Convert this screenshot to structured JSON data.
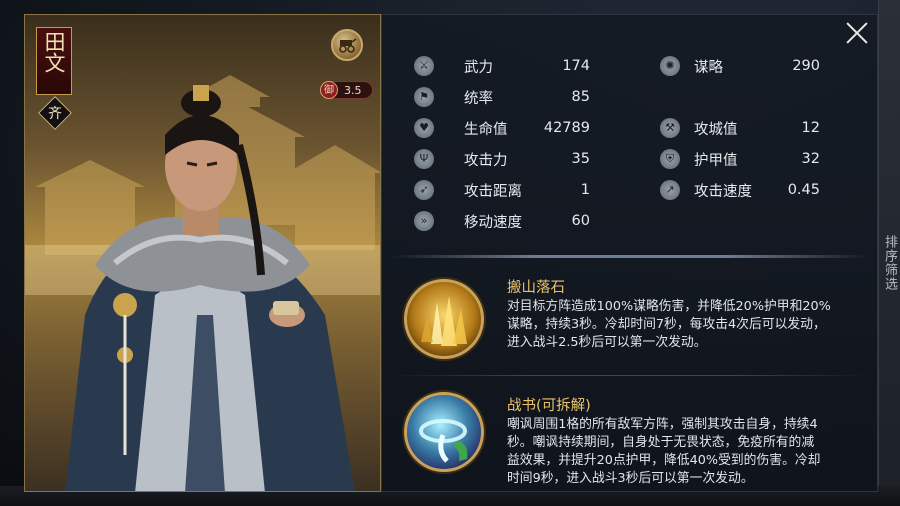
{
  "hero": {
    "name": "田文",
    "nation": "齐",
    "defense_badge": {
      "icon_text": "御",
      "value": "3.5"
    },
    "type_icon": "cart-icon"
  },
  "stats_left": [
    {
      "label": "武力",
      "value": "174",
      "icon": "crossed-swords-icon"
    },
    {
      "label": "统率",
      "value": "85",
      "icon": "banner-icon"
    },
    {
      "label": "生命值",
      "value": "42789",
      "icon": "heart-icon"
    },
    {
      "label": "攻击力",
      "value": "35",
      "icon": "trident-icon"
    },
    {
      "label": "攻击距离",
      "value": "1",
      "icon": "bow-icon"
    },
    {
      "label": "移动速度",
      "value": "60",
      "icon": "boot-icon"
    }
  ],
  "stats_right": [
    {
      "label": "谋略",
      "value": "290",
      "icon": "brain-icon"
    },
    {
      "label": "攻城值",
      "value": "12",
      "icon": "catapult-icon"
    },
    {
      "label": "护甲值",
      "value": "32",
      "icon": "shield-icon"
    },
    {
      "label": "攻击速度",
      "value": "0.45",
      "icon": "spear-icon"
    }
  ],
  "skills": [
    {
      "name": "搬山落石",
      "icon": "falling-rocks-icon",
      "lines": [
        "对目标方阵造成100%谋略伤害，并降低20%护甲和20%",
        "谋略，持续3秒。冷却时间7秒，每攻击4次后可以发动，",
        "进入战斗2.5秒后可以第一次发动。"
      ]
    },
    {
      "name": "战书(可拆解)",
      "icon": "war-scroll-icon",
      "lines": [
        "嘲讽周围1格的所有敌军方阵，强制其攻击自身，持续4",
        "秒。嘲讽持续期间，自身处于无畏状态，免疫所有的减",
        "益效果，并提升20点护甲，降低40%受到的伤害。冷却",
        "时间9秒，进入战斗3秒后可以第一次发动。"
      ]
    }
  ],
  "side_menu": {
    "label": "排序筛选"
  },
  "colors": {
    "skill_title": "#e8c36c",
    "text": "#e6e9ee",
    "frame_gold": "#c8a25a"
  }
}
